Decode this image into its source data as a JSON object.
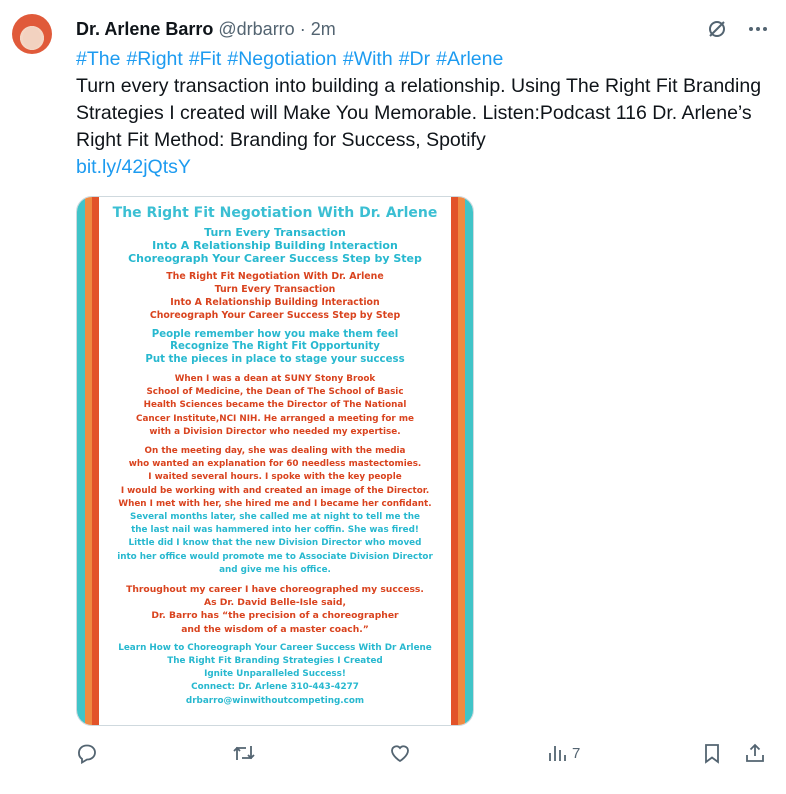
{
  "tweet": {
    "author_name": "Dr. Arlene Barro",
    "handle": "@drbarro",
    "separator": "·",
    "time": "2m",
    "hashtags": [
      "#The",
      "#Right",
      "#Fit",
      "#Negotiation",
      "#With",
      "#Dr",
      "#Arlene"
    ],
    "body": "Turn every transaction into building a relationship. Using The Right Fit Branding Strategies I created will Make You Memorable. Listen:Podcast 116 Dr. Arlene’s Right Fit Method: Branding for Success, Spotify",
    "link": "bit.ly/42jQtsY"
  },
  "flyer": {
    "title": "The Right Fit Negotiation With Dr. Arlene",
    "block1": [
      "Turn Every Transaction",
      "Into A Relationship Building Interaction",
      "Choreograph Your Career Success Step by Step"
    ],
    "block2": [
      "The Right Fit Negotiation With Dr. Arlene",
      "Turn Every Transaction",
      "Into A Relationship Building Interaction",
      "Choreograph Your Career Success Step by Step"
    ],
    "block3": [
      "People remember how you make them feel",
      "Recognize The Right Fit Opportunity",
      "Put the pieces in place to stage your success"
    ],
    "block4": [
      "When I was a dean at SUNY Stony Brook",
      "School of Medicine, the Dean of The School of Basic",
      "Health Sciences became the Director of The National",
      "Cancer Institute,NCI NIH. He arranged a meeting for me",
      "with a Division Director who needed my expertise."
    ],
    "block5": [
      "On the meeting day, she was dealing with the media",
      "who wanted an explanation for 60 needless mastectomies.",
      "I waited several hours. I spoke with the key people",
      "I would be working with and created an image of the Director.",
      "When I met with her, she hired me and I became her confidant.",
      "Several months later, she called me at night to tell me the",
      "the last nail was hammered into her coffin. She was fired!",
      "Little did I know that the new Division Director who moved",
      "into her office would promote me to Associate Division Director",
      "and give me his office."
    ],
    "block6": [
      "Throughout my career I have choreographed my success.",
      "As Dr. David Belle-Isle said,",
      "Dr. Barro has “the precision of a choreographer",
      "and the wisdom of a master coach.”"
    ],
    "block7": [
      "Learn How to Choreograph Your Career Success With Dr Arlene",
      "The Right Fit Branding Strategies I Created",
      "Ignite Unparalleled Success!",
      "Connect: Dr. Arlene 310-443-4277",
      "drbarro@winwithoutcompeting.com"
    ]
  },
  "actions": {
    "views_count": "7"
  },
  "icons": {
    "reply": "reply-icon",
    "retweet": "retweet-icon",
    "like": "like-icon",
    "views": "views-icon",
    "bookmark": "bookmark-icon",
    "share": "share-icon",
    "grok": "grok-icon",
    "more": "more-icon"
  },
  "colors": {
    "link": "#1d9bf0",
    "muted": "#536471",
    "flyer_teal": "#27b8cf",
    "flyer_red": "#d9431e",
    "flyer_orange": "#ef8a42"
  }
}
